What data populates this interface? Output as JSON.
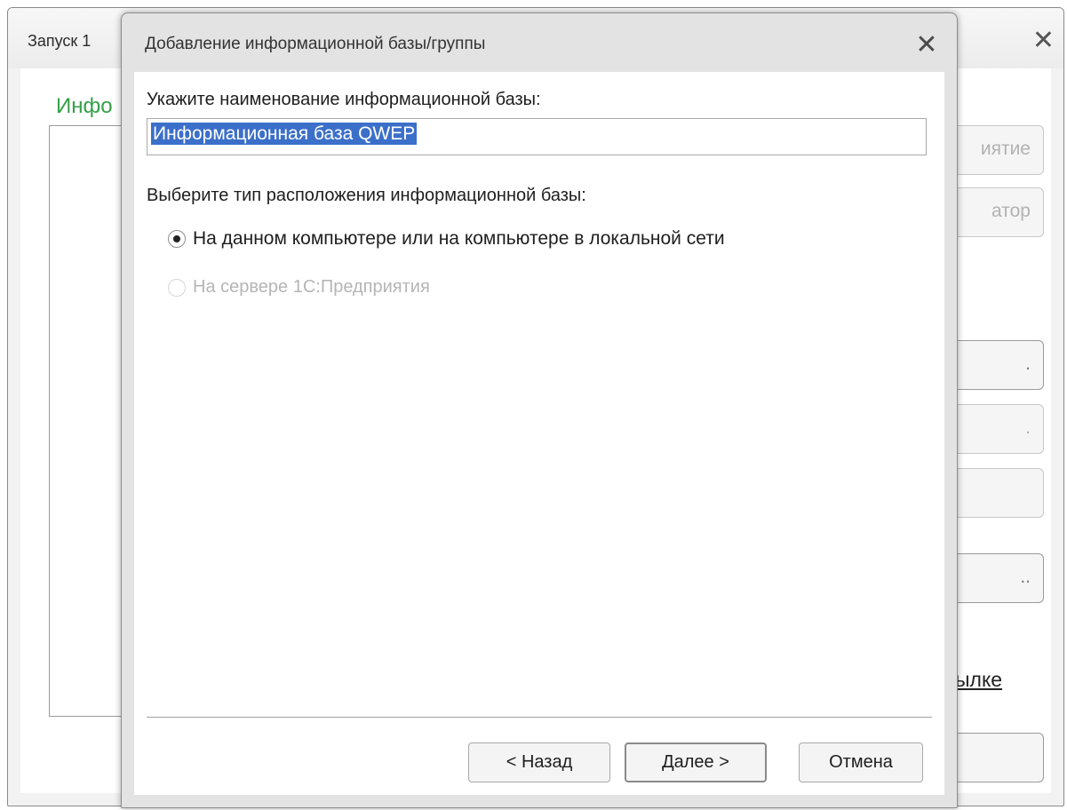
{
  "background_window": {
    "title": "Запуск 1",
    "close_glyph": "✕",
    "heading": "Инфо",
    "buttons": [
      "иятие",
      "атор",
      ".",
      ".",
      "",
      "..",
      ""
    ],
    "link": "ылке"
  },
  "dialog": {
    "title": "Добавление информационной базы/группы",
    "close_glyph": "✕",
    "name_label": "Укажите наименование информационной базы:",
    "name_value": "Информационная база QWEP",
    "type_label": "Выберите тип расположения информационной базы:",
    "options": [
      {
        "label": "На данном компьютере или на компьютере в локальной сети",
        "selected": true,
        "enabled": true
      },
      {
        "label": "На сервере 1С:Предприятия",
        "selected": false,
        "enabled": false
      }
    ],
    "buttons": {
      "back": "< Назад",
      "next": "Далее >",
      "cancel": "Отмена"
    }
  },
  "colors": {
    "heading_green": "#35a048",
    "selection_blue": "#3b6fc9",
    "dialog_frame": "#e3e3e3"
  }
}
